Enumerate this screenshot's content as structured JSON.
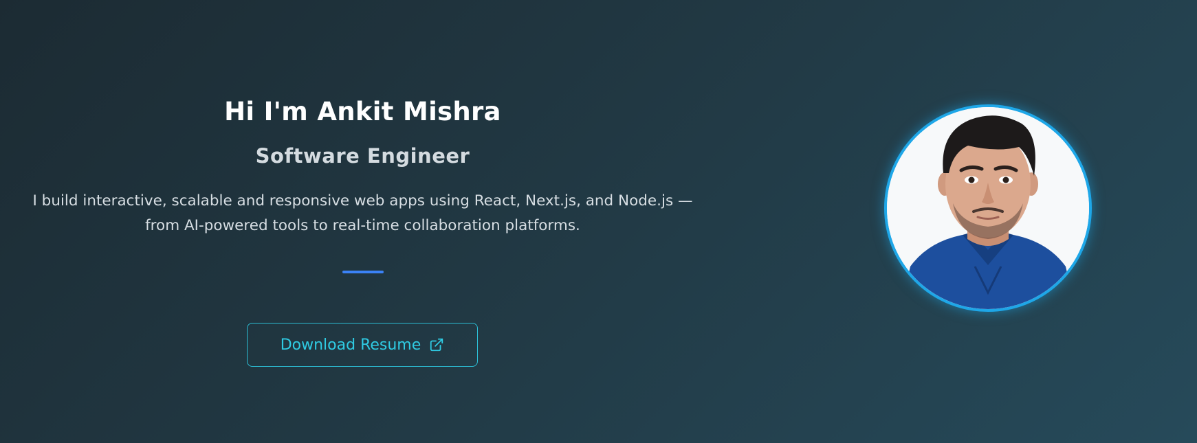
{
  "hero": {
    "name": "Hi I'm Ankit Mishra",
    "role": "Software Engineer",
    "bio_line1": "I build interactive, scalable and responsive web apps using React, Next.js, and Node.js —",
    "bio_line2": "from AI-powered tools to real-time collaboration platforms.",
    "resume_label": "Download Resume",
    "resume_icon": "external-link-icon"
  },
  "profile": {
    "avatar": "profile-photo"
  },
  "colors": {
    "accent": "#2fcbe3",
    "divider": "#3b82f6",
    "avatar_ring": "#1ea7e8",
    "background_start": "#1c2b33",
    "background_end": "#264a5a"
  }
}
